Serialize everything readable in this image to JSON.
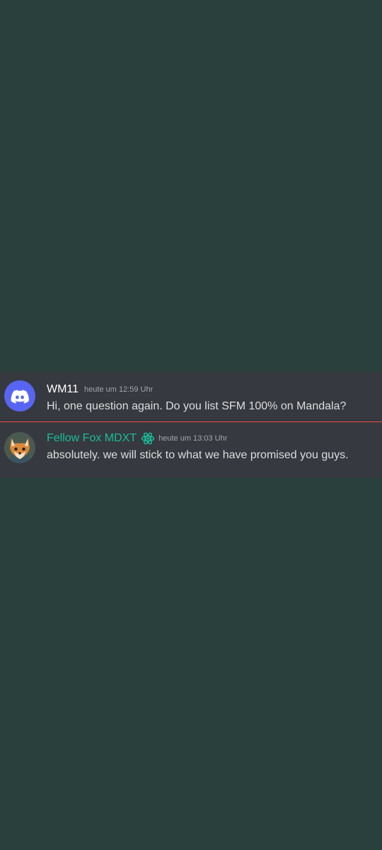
{
  "messages": [
    {
      "author": "WM11",
      "timestamp": "heute um 12:59 Uhr",
      "text": "Hi, one question again. Do you list SFM 100% on Mandala?",
      "avatar_icon": "discord-logo-icon",
      "author_color": "#ffffff"
    },
    {
      "author": "Fellow Fox MDXT",
      "timestamp": "heute um 13:03 Uhr",
      "text": "absolutely. we will stick to what we have promised you guys.",
      "avatar_icon": "fox-avatar-icon",
      "role_icon": "atom-role-icon",
      "author_color": "#1abc9c"
    }
  ],
  "colors": {
    "background": "#29403c",
    "chat_background": "#36393f",
    "new_messages_divider": "#f04747",
    "brand_blurple": "#5865f2"
  }
}
